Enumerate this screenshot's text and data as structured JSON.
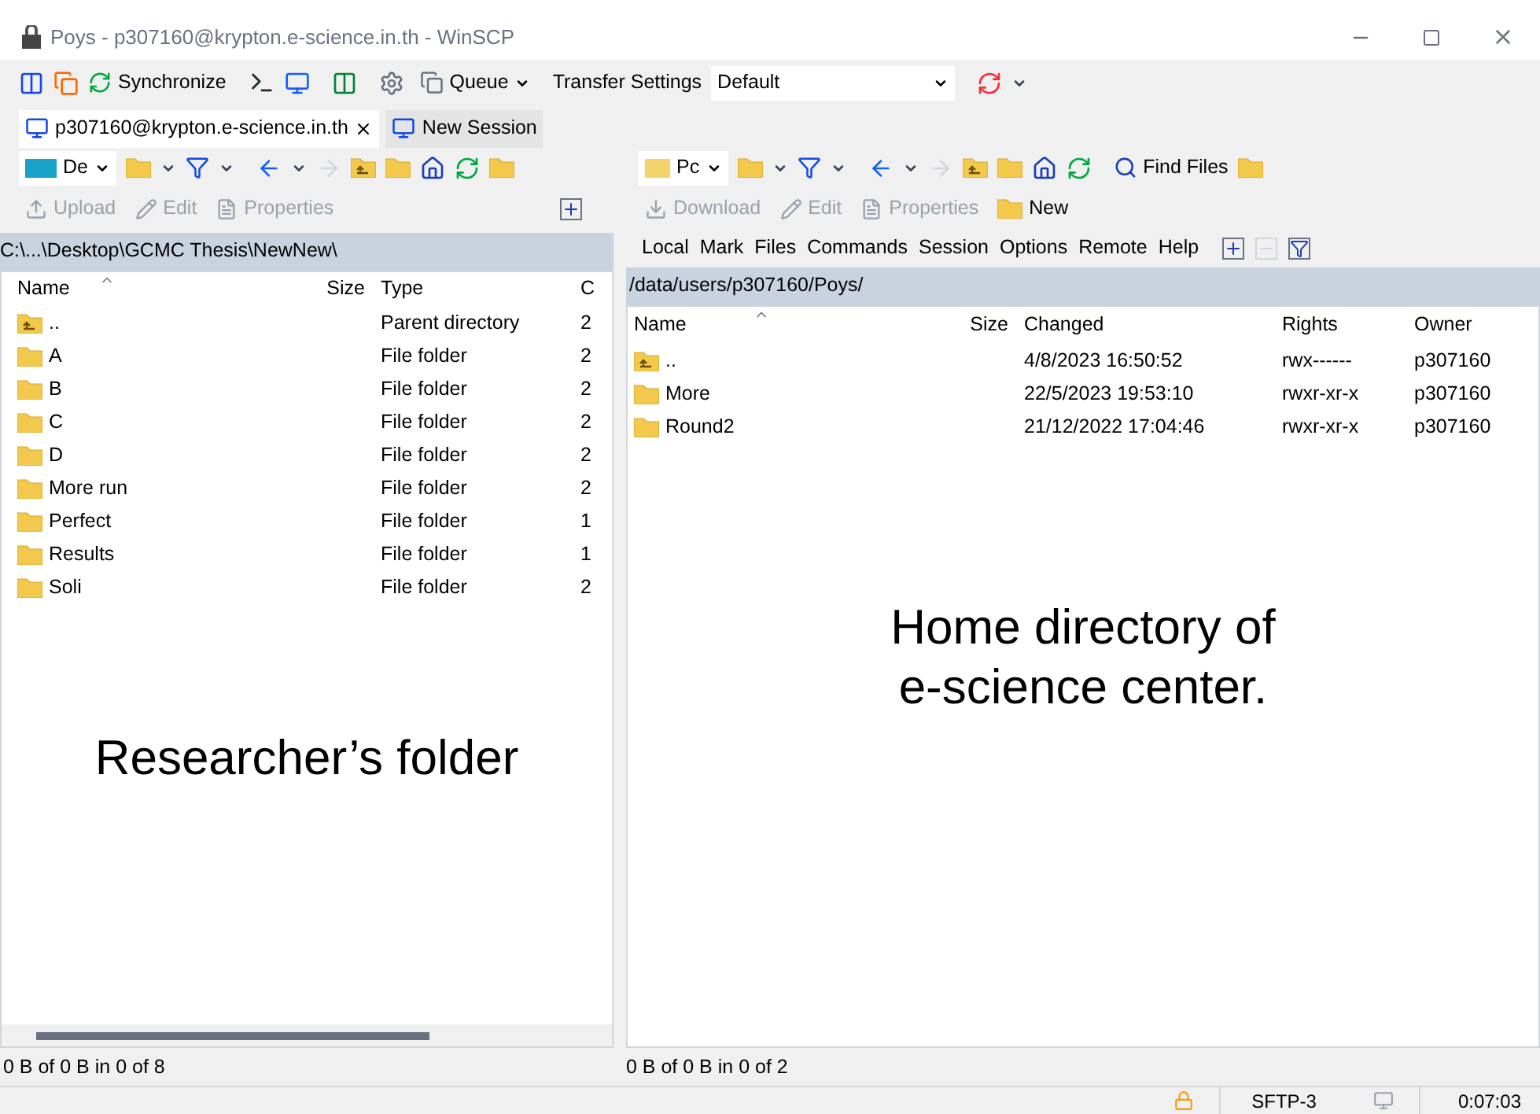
{
  "window": {
    "title": "Poys - p307160@krypton.e-science.in.th - WinSCP"
  },
  "toolbar": {
    "synchronize": "Synchronize",
    "queue": "Queue",
    "transfer_settings_label": "Transfer Settings",
    "transfer_settings_value": "Default"
  },
  "session_tabs": [
    {
      "label": "p307160@krypton.e-science.in.th",
      "selected": true
    },
    {
      "label": "New Session",
      "selected": false
    }
  ],
  "left_panel": {
    "drive": "De",
    "actions": [
      {
        "label": "Upload",
        "disabled": true
      },
      {
        "label": "Edit",
        "disabled": true
      },
      {
        "label": "Properties",
        "disabled": true
      }
    ],
    "path": "C:\\...\\Desktop\\GCMC Thesis\\NewNew\\",
    "columns": [
      "Name",
      "Size",
      "Type",
      "C"
    ],
    "rows": [
      {
        "kind": "parent",
        "name": "..",
        "size": "",
        "type": "Parent directory",
        "column_4": "2"
      },
      {
        "kind": "folder",
        "name": "A",
        "type": "File folder",
        "column_4": "2"
      },
      {
        "kind": "folder",
        "name": "B",
        "type": "File folder",
        "column_4": "2"
      },
      {
        "kind": "folder",
        "name": "C",
        "type": "File folder",
        "column_4": "2"
      },
      {
        "kind": "folder",
        "name": "D",
        "type": "File folder",
        "column_4": "2"
      },
      {
        "kind": "folder",
        "name": "More run",
        "type": "File folder",
        "column_4": "2"
      },
      {
        "kind": "folder",
        "name": "Perfect",
        "type": "File folder",
        "column_4": "1"
      },
      {
        "kind": "folder",
        "name": "Results",
        "type": "File folder",
        "column_4": "1"
      },
      {
        "kind": "folder",
        "name": "Soli",
        "type": "File folder",
        "column_4": "2"
      }
    ],
    "annotation": "Researcher’s folder",
    "status": "0 B of 0 B in 0 of 8"
  },
  "right_panel": {
    "drive": "Pc",
    "find_files": "Find Files",
    "actions": [
      {
        "label": "Download",
        "disabled": true
      },
      {
        "label": "Edit",
        "disabled": true
      },
      {
        "label": "Properties",
        "disabled": true
      },
      {
        "label": "New",
        "disabled": false
      }
    ],
    "menu": [
      "Local",
      "Mark",
      "Files",
      "Commands",
      "Session",
      "Options",
      "Remote",
      "Help"
    ],
    "path": "/data/users/p307160/Poys/",
    "columns": [
      "Name",
      "Size",
      "Changed",
      "Rights",
      "Owner"
    ],
    "rows": [
      {
        "kind": "parent",
        "name": "..",
        "changed": "4/8/2023 16:50:52",
        "rights": "rwx------",
        "owner": "p307160"
      },
      {
        "kind": "folder",
        "name": "More",
        "changed": "22/5/2023 19:53:10",
        "rights": "rwxr-xr-x",
        "owner": "p307160"
      },
      {
        "kind": "folder",
        "name": "Round2",
        "changed": "21/12/2022 17:04:46",
        "rights": "rwxr-xr-x",
        "owner": "p307160"
      }
    ],
    "annotation": [
      "Home directory of",
      "e-science center."
    ],
    "status": "0 B of 0 B in 0 of 2"
  },
  "status_bar": {
    "protocol": "SFTP-3",
    "time": "0:07:03"
  }
}
